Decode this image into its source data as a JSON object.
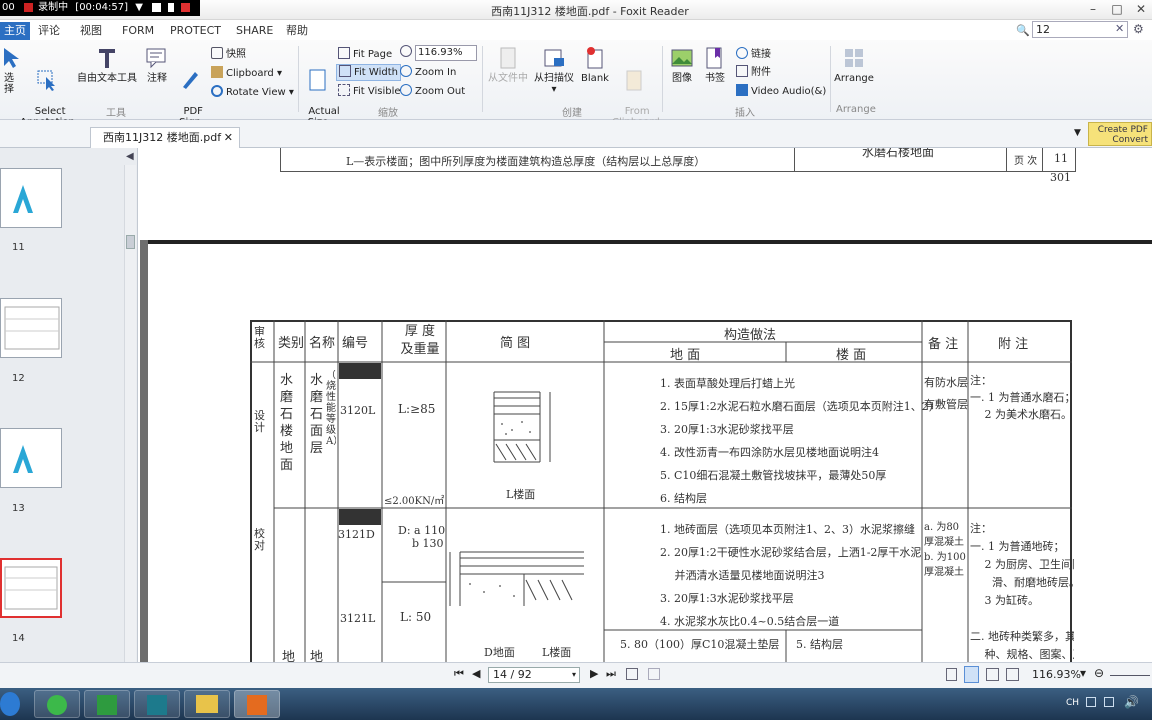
{
  "recorder": {
    "left_text": "00",
    "status": "录制中",
    "time": "[00:04:57]"
  },
  "window": {
    "title": "西南11J312 楼地面.pdf - Foxit Reader"
  },
  "menu": {
    "tabs": [
      "主页",
      "评论",
      "视图",
      "FORM",
      "PROTECT",
      "SHARE",
      "帮助"
    ],
    "search_value": "12"
  },
  "ribbon": {
    "select": "选择",
    "select_annotation": "Select\nAnnotation",
    "text_tool": "自由文本工具",
    "annotate": "注释",
    "pdf_sign": "PDF\nSign",
    "snapshot": "快照",
    "clipboard": "Clipboard",
    "rotate_view": "Rotate View",
    "tools_group": "工具",
    "actual_size": "Actual\nSize",
    "fit_page": "Fit Page",
    "fit_width": "Fit Width",
    "fit_visible": "Fit Visible",
    "zoom_value": "116.93%",
    "zoom_in": "Zoom In",
    "zoom_out": "Zoom Out",
    "zoom_group": "缩放",
    "from_file": "从文件中",
    "from_scanner": "从扫描仪",
    "blank": "Blank",
    "from_clipboard": "From\nClipboard",
    "create_group": "创建",
    "image": "图像",
    "bookmark": "书签",
    "link": "链接",
    "attachment": "附件",
    "video_audio": "Video Audio(&)",
    "insert_group": "插入",
    "arrange": "Arrange",
    "arrange_group": "Arrange"
  },
  "doctab": {
    "name": "西南11J312 楼地面.pdf",
    "create_pdf": "Create PDF\nConvert"
  },
  "thumbnails": [
    {
      "num": "11"
    },
    {
      "num": "12"
    },
    {
      "num": "13"
    },
    {
      "num": "14"
    }
  ],
  "page_prev": {
    "note": "L—表示楼面；图中所列厚度为楼面建筑构造总厚度（结构层以上总厚度）",
    "title": "水磨石楼地面",
    "page_label": "页 次",
    "page_no": "11",
    "page_num": "301"
  },
  "table": {
    "header": {
      "category": "类别",
      "name": "名称",
      "code": "编号",
      "thickness": "厚 度\n及重量",
      "sketch": "简 图",
      "construction": "构造做法",
      "ground": "地 面",
      "floor": "楼 面",
      "remark": "备 注",
      "appendix": "附 注"
    },
    "left_strip": [
      "审核",
      "设计",
      "校对"
    ],
    "row1": {
      "category": "水\n磨\n石\n楼\n地\n面",
      "name": "水\n磨\n石\n面\n层",
      "name_note": "（燃烧性能等级A）",
      "code": "3120L",
      "thickness": "L:≥85",
      "weight": "≤2.00KN/㎡",
      "sketch_label": "L楼面",
      "steps": [
        "1. 表面草酸处理后打蜡上光",
        "2. 15厚1:2水泥石粒水磨石面层（选项见本页附注1、2）",
        "3. 20厚1:3水泥砂浆找平层",
        "4. 改性沥青一布四涂防水层见楼地面说明注4",
        "5. C10细石混凝土敷管找坡抹平，最薄处50厚",
        "6. 结构层"
      ],
      "remark": "有防水层\n有敷管层",
      "appendix": "注：\n一. 1 为普通水磨石；\n　 2 为美术水磨石。"
    },
    "row2": {
      "code_a": "3121D",
      "thickness_a": "D: a 110\n    b 130",
      "code_b": "3121L",
      "thickness_b": "L: 50",
      "sketch_d": "D地面",
      "sketch_l": "L楼面",
      "steps": [
        "1. 地砖面层（选项见本页附注1、2、3）水泥浆擦缝",
        "2. 20厚1:2干硬性水泥砂浆结合层，上洒1-2厚干水泥",
        "　 并洒清水适量见楼地面说明注3",
        "3. 20厚1:3水泥砂浆找平层",
        "4. 水泥浆水灰比0.4~0.5结合层一道"
      ],
      "step5_ground": "5. 80（100）厚C10混凝土垫层",
      "step5_floor": "5. 结构层",
      "remark": "a. 为80\n厚混凝土\nb. 为100\n厚混凝土",
      "appendix": "注：\n一. 1 为普通地砖；\n　 2 为厨房、卫生间防\n　　滑、耐磨地砖层。\n　 3 为缸砖。\n\n二. 地砖种类繁多，其品\n　 种、规格、图案、及",
      "category": "地",
      "name": "地"
    }
  },
  "nav": {
    "page": "14 / 92",
    "zoom": "116.93%"
  },
  "taskbar": {
    "tray": "CH"
  }
}
